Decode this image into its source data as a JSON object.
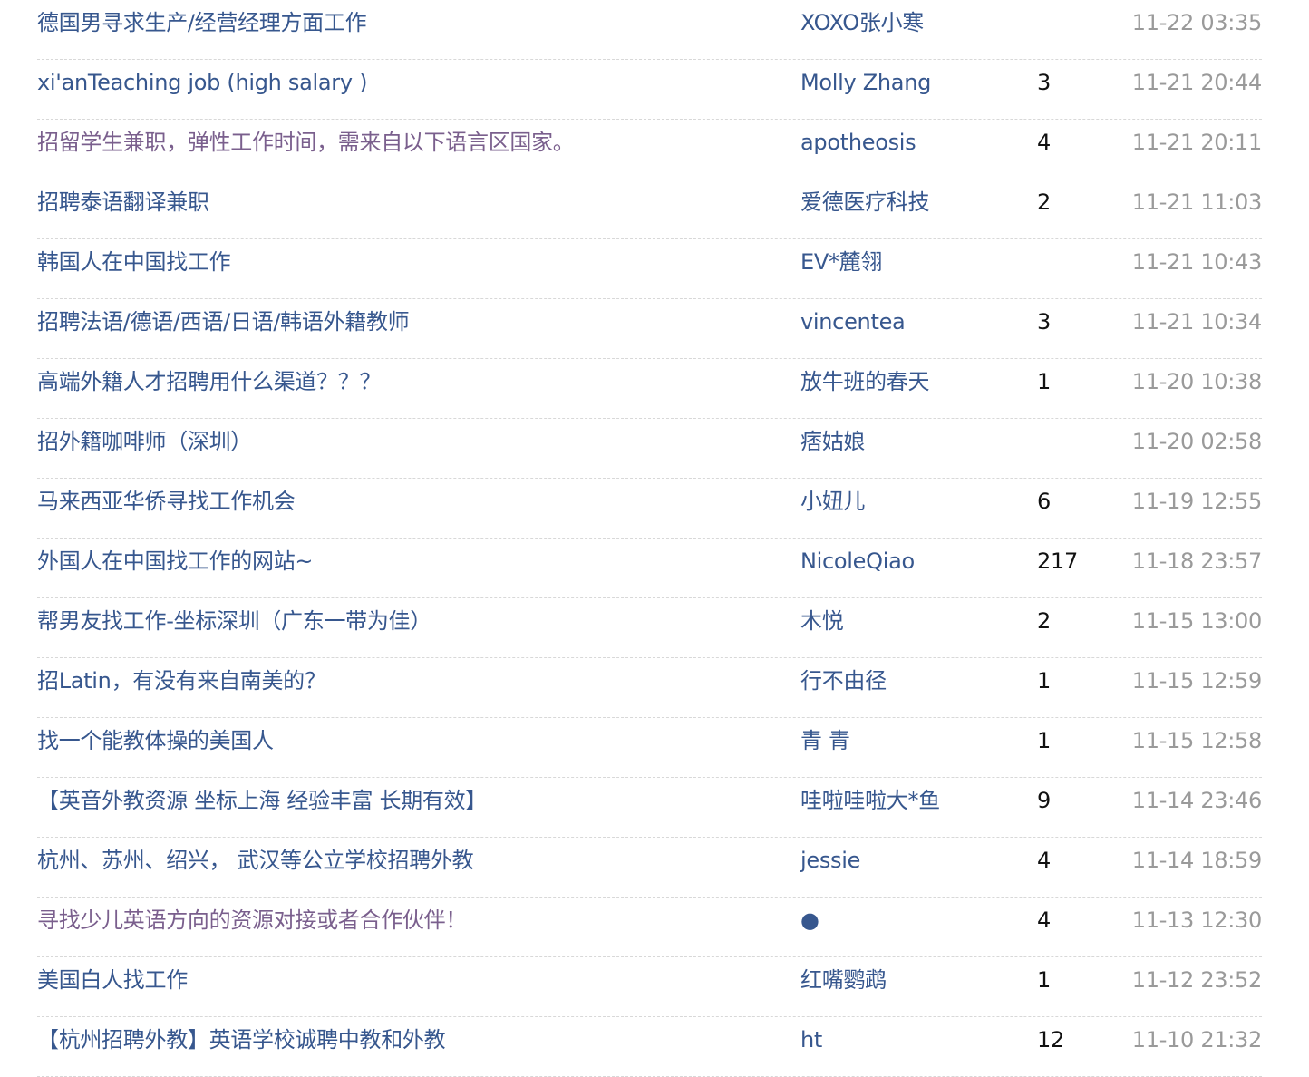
{
  "topics": [
    {
      "title": "德国男寻求生产/经营经理方面工作",
      "author": "XOXO张小寒",
      "replies": "",
      "time": "11-22 03:35",
      "visited": false
    },
    {
      "title": "xi'anTeaching job (high salary )",
      "author": "Molly Zhang",
      "replies": "3",
      "time": "11-21 20:44",
      "visited": false
    },
    {
      "title": "招留学生兼职，弹性工作时间，需来自以下语言区国家。",
      "author": "apotheosis",
      "replies": "4",
      "time": "11-21 20:11",
      "visited": true
    },
    {
      "title": "招聘泰语翻译兼职",
      "author": "爱德医疗科技",
      "replies": "2",
      "time": "11-21 11:03",
      "visited": false
    },
    {
      "title": "韩国人在中国找工作",
      "author": "EV*麓翎",
      "replies": "",
      "time": "11-21 10:43",
      "visited": false
    },
    {
      "title": "招聘法语/德语/西语/日语/韩语外籍教师",
      "author": "vincentea",
      "replies": "3",
      "time": "11-21 10:34",
      "visited": false
    },
    {
      "title": "高端外籍人才招聘用什么渠道？？？",
      "author": "放牛班的春天",
      "replies": "1",
      "time": "11-20 10:38",
      "visited": false
    },
    {
      "title": "招外籍咖啡师（深圳）",
      "author": "痞姑娘",
      "replies": "",
      "time": "11-20 02:58",
      "visited": false
    },
    {
      "title": "马来西亚华侨寻找工作机会",
      "author": "小妞儿",
      "replies": "6",
      "time": "11-19 12:55",
      "visited": false
    },
    {
      "title": "外国人在中国找工作的网站~",
      "author": "NicoleQiao",
      "replies": "217",
      "time": "11-18 23:57",
      "visited": false
    },
    {
      "title": "帮男友找工作-坐标深圳（广东一带为佳）",
      "author": "木悦",
      "replies": "2",
      "time": "11-15 13:00",
      "visited": false
    },
    {
      "title": "招Latin，有没有来自南美的？",
      "author": "行不由径",
      "replies": "1",
      "time": "11-15 12:59",
      "visited": false
    },
    {
      "title": "找一个能教体操的美国人",
      "author": "青 青",
      "replies": "1",
      "time": "11-15 12:58",
      "visited": false
    },
    {
      "title": "【英音外教资源 坐标上海 经验丰富 长期有效】",
      "author": "哇啦哇啦大*鱼",
      "replies": "9",
      "time": "11-14 23:46",
      "visited": false
    },
    {
      "title": "杭州、苏州、绍兴， 武汉等公立学校招聘外教",
      "author": "jessie",
      "replies": "4",
      "time": "11-14 18:59",
      "visited": false
    },
    {
      "title": "寻找少儿英语方向的资源对接或者合作伙伴！",
      "author": "●",
      "replies": "4",
      "time": "11-13 12:30",
      "visited": true
    },
    {
      "title": "美国白人找工作",
      "author": "红嘴鹦鹉",
      "replies": "1",
      "time": "11-12 23:52",
      "visited": false
    },
    {
      "title": "【杭州招聘外教】英语学校诚聘中教和外教",
      "author": "ht",
      "replies": "12",
      "time": "11-10 21:32",
      "visited": false
    }
  ],
  "colors": {
    "link": "#37578e",
    "visited_link": "#7a5f8d",
    "count": "#111111",
    "time": "#9a9a9a",
    "divider": "#d8d8d8"
  }
}
